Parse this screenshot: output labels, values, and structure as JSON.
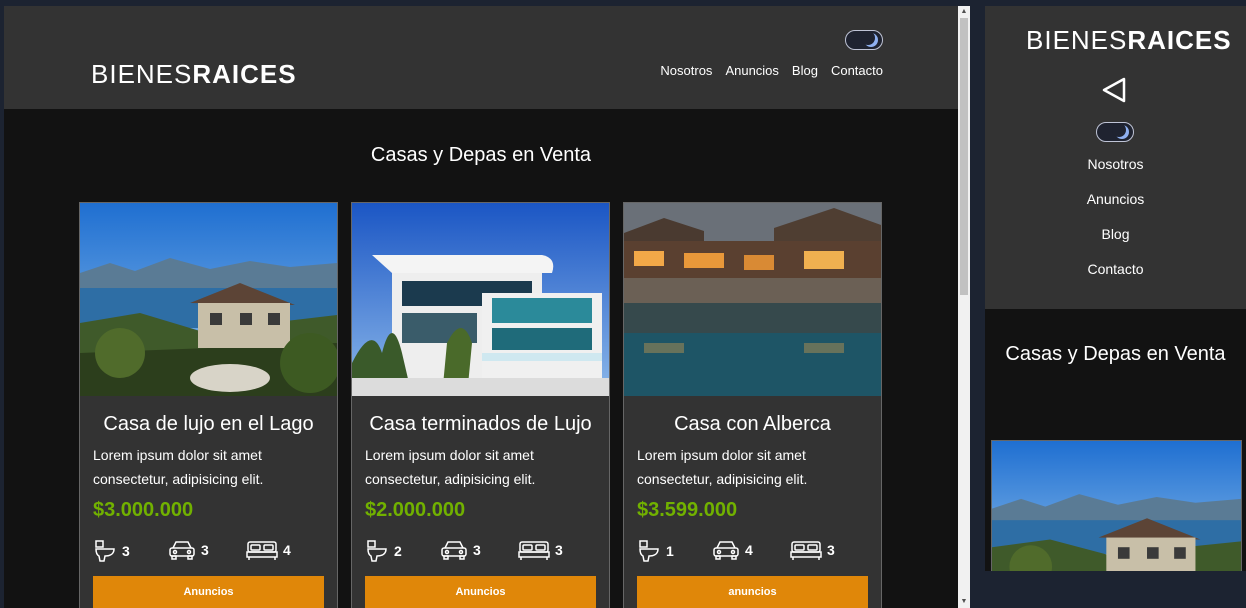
{
  "site": {
    "logo_thin": "BIENES",
    "logo_bold": "RAICES"
  },
  "nav": [
    "Nosotros",
    "Anuncios",
    "Blog",
    "Contacto"
  ],
  "section_title": "Casas y Depas en Venta",
  "cards": [
    {
      "title": "Casa de lujo en el Lago",
      "description": "Lorem ipsum dolor sit amet consectetur, adipisicing elit.",
      "price": "$3.000.000",
      "wc": "3",
      "parking": "3",
      "bedrooms": "4",
      "button": "Anuncios"
    },
    {
      "title": "Casa terminados de Lujo",
      "description": "Lorem ipsum dolor sit amet consectetur, adipisicing elit.",
      "price": "$2.000.000",
      "wc": "2",
      "parking": "3",
      "bedrooms": "3",
      "button": "Anuncios"
    },
    {
      "title": "Casa con Alberca",
      "description": "Lorem ipsum dolor sit amet consectetur, adipisicing elit.",
      "price": "$3.599.000",
      "wc": "1",
      "parking": "4",
      "bedrooms": "3",
      "button": "anuncios"
    }
  ],
  "icons": {
    "wc": "toilet-icon",
    "parking": "car-icon",
    "bedrooms": "bed-icon",
    "menu": "menu-triangle-icon",
    "dark_mode": "moon-icon"
  },
  "colors": {
    "header_bg": "#333333",
    "page_bg": "#121212",
    "price": "#71b100",
    "button": "#e08709"
  }
}
